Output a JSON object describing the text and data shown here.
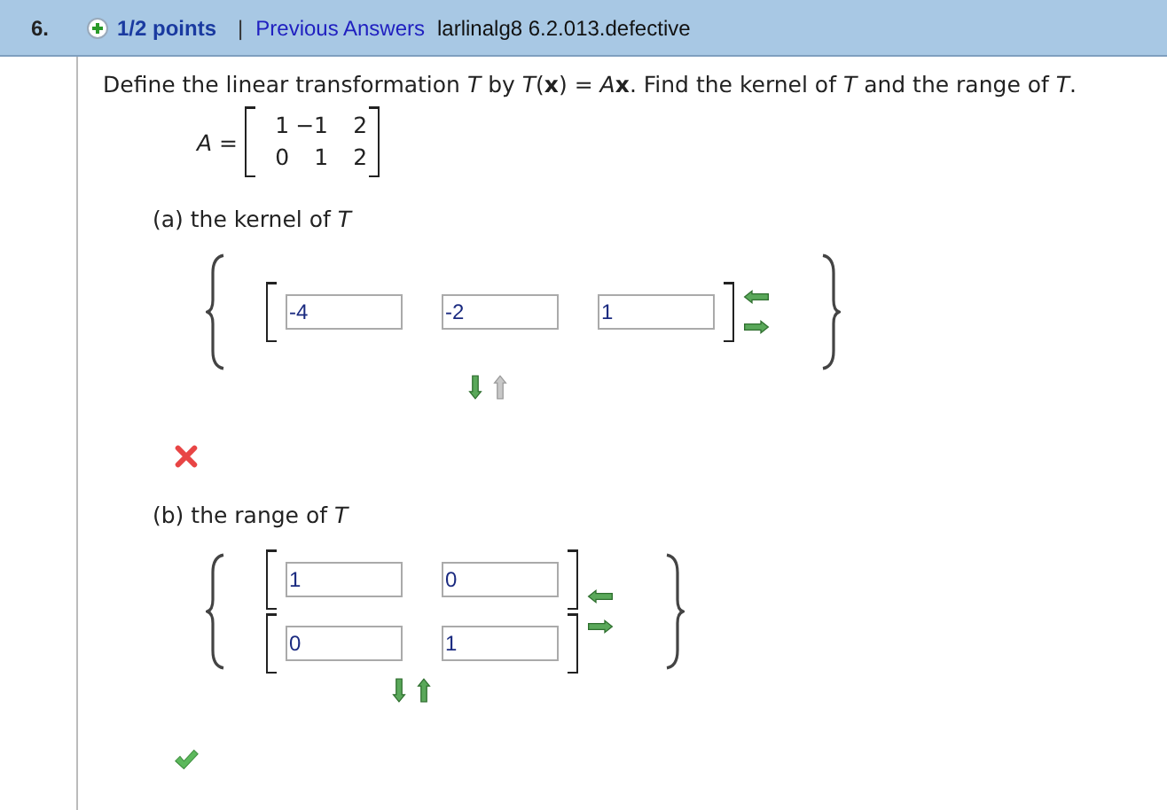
{
  "question": {
    "number": "6.",
    "points": "1/2 points",
    "separator": "|",
    "previous_answers": "Previous Answers",
    "source": "larlinalg8 6.2.013.defective"
  },
  "prompt": [
    "Define the linear transformation *T* by  *T*(**x**) = *A*",
    "**x**.  Find the kernel of *T* and the range of *T*."
  ],
  "matrix": {
    "name": "A",
    "equals": "=",
    "rows": [
      [
        "1",
        "−1",
        "2"
      ],
      [
        "0",
        "1",
        "2"
      ]
    ]
  },
  "parts": [
    {
      "label": "(a) the kernel of ",
      "variable": "T",
      "vectors": [
        [
          "-4",
          "-2",
          "1"
        ]
      ],
      "arrows": [
        {
          "kind": "left",
          "disabled": false
        },
        {
          "kind": "right",
          "disabled": false
        },
        {
          "kind": "down",
          "disabled": false
        },
        {
          "kind": "up",
          "disabled": true
        }
      ],
      "correct": false
    },
    {
      "label": "(b) the range of ",
      "variable": "T",
      "vectors": [
        [
          "1",
          "0"
        ],
        [
          "0",
          "1"
        ]
      ],
      "arrows": [
        {
          "kind": "left",
          "disabled": false
        },
        {
          "kind": "right",
          "disabled": false
        },
        {
          "kind": "down",
          "disabled": false
        },
        {
          "kind": "up",
          "disabled": false
        }
      ],
      "correct": true
    }
  ]
}
